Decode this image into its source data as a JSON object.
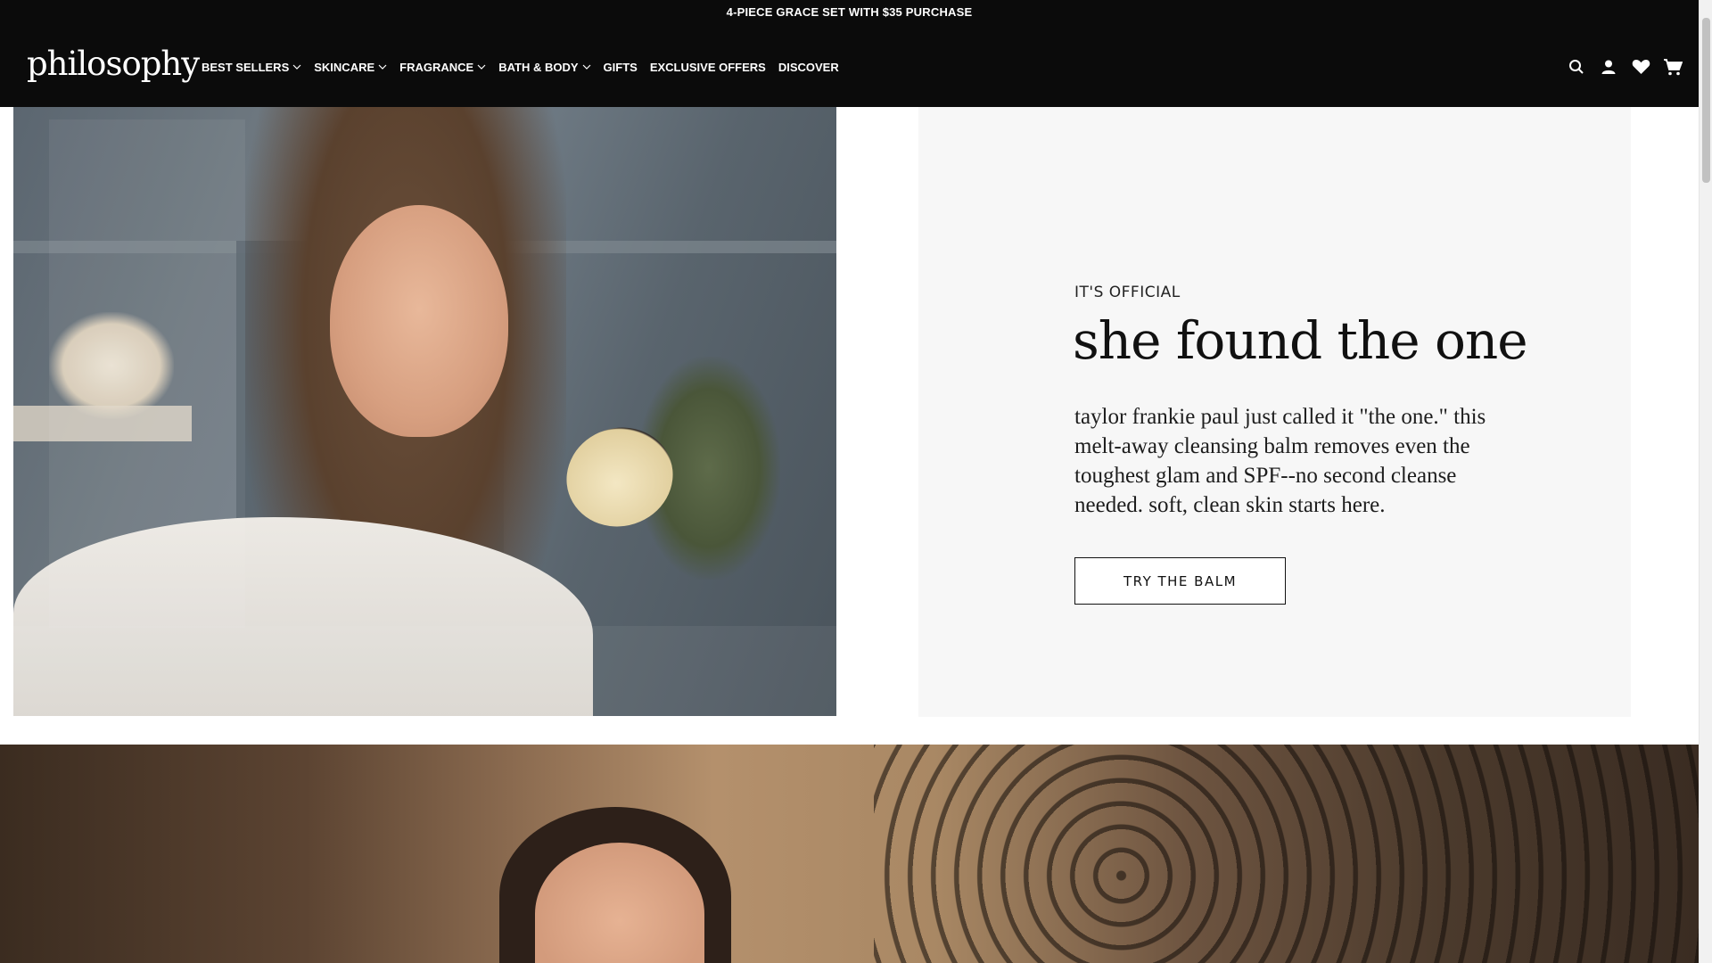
{
  "promo": {
    "text": "4-PIECE GRACE SET WITH $35 PURCHASE"
  },
  "header": {
    "logo": "philosophy",
    "nav": [
      {
        "label": "BEST SELLERS",
        "has_dropdown": true
      },
      {
        "label": "SKINCARE",
        "has_dropdown": true
      },
      {
        "label": "FRAGRANCE",
        "has_dropdown": true
      },
      {
        "label": "BATH & BODY",
        "has_dropdown": true
      },
      {
        "label": "GIFTS",
        "has_dropdown": false
      },
      {
        "label": "EXCLUSIVE OFFERS",
        "has_dropdown": false
      },
      {
        "label": "DISCOVER",
        "has_dropdown": false
      }
    ],
    "icons": [
      "search-icon",
      "account-icon",
      "wishlist-heart-icon",
      "cart-icon"
    ]
  },
  "hero": {
    "eyebrow": "IT'S OFFICIAL",
    "headline": "she found the one",
    "body": "taylor frankie paul just called it \"the one.\" this melt-away cleansing balm removes even the toughest glam and SPF--no second cleanse needed. soft, clean skin starts here.",
    "cta": "TRY THE BALM"
  },
  "colors": {
    "header_bg": "#0b0b0b",
    "card_bg": "#f7f7f7",
    "text_dark": "#111111"
  }
}
